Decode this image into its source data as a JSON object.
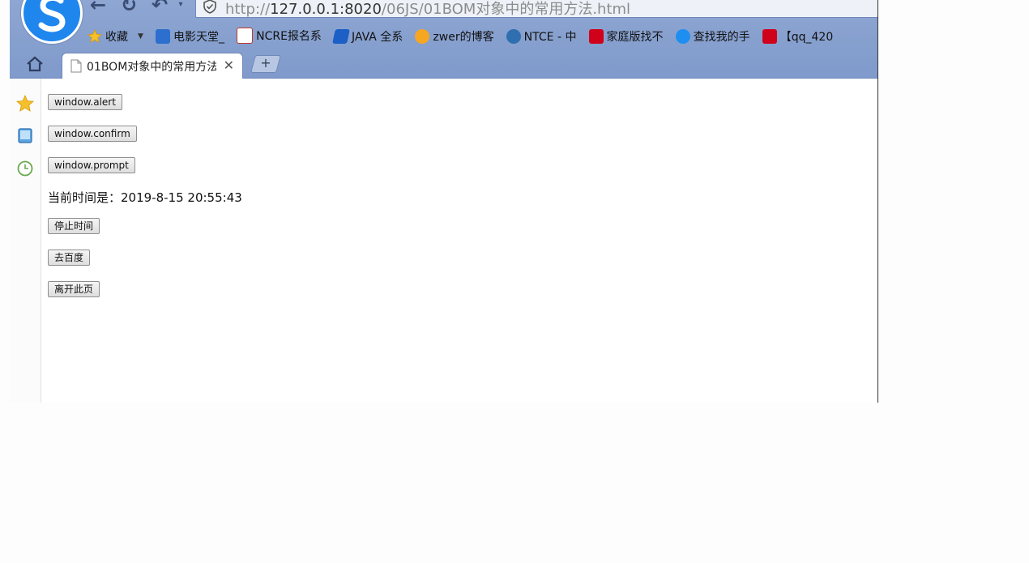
{
  "browser": {
    "address_url_prefix": "http://",
    "address_url_host": "127.0.0.1:8020",
    "address_url_path": "/06JS/01BOM对象中的常用方法.html",
    "bookmarks": [
      {
        "label": "收藏",
        "icon": "star-icon",
        "color": "#f4b400"
      },
      {
        "label": "电影天堂_",
        "icon": "movie-site-icon",
        "color": "#2c6fcf"
      },
      {
        "label": "NCRE报名系",
        "icon": "ncre-icon",
        "color": "#c0392b"
      },
      {
        "label": "JAVA 全系",
        "icon": "java-site-icon",
        "color": "#1b5fc7"
      },
      {
        "label": "zwer的博客",
        "icon": "blog-icon",
        "color": "#f5a623"
      },
      {
        "label": "NTCE - 中",
        "icon": "ntce-icon",
        "color": "#2f6fb0"
      },
      {
        "label": "家庭版找不",
        "icon": "csdn-icon",
        "color": "#d0021b"
      },
      {
        "label": "查找我的手",
        "icon": "cloud-icon",
        "color": "#1e8ef0"
      },
      {
        "label": "【qq_420",
        "icon": "csdn-icon",
        "color": "#d0021b"
      }
    ],
    "tab": {
      "title": "01BOM对象中的常用方法",
      "close": "✕"
    },
    "new_tab": "+"
  },
  "page": {
    "buttons": {
      "alert": "window.alert",
      "confirm": "window.confirm",
      "prompt": "window.prompt",
      "stop_time": "停止时间",
      "go_baidu": "去百度",
      "leave_page": "离开此页"
    },
    "time_label": "当前时间是：",
    "time_value": "2019-8-15 20:55:43"
  },
  "colors": {
    "chrome": "#8ea6d2",
    "logo": "#1f86ee"
  }
}
